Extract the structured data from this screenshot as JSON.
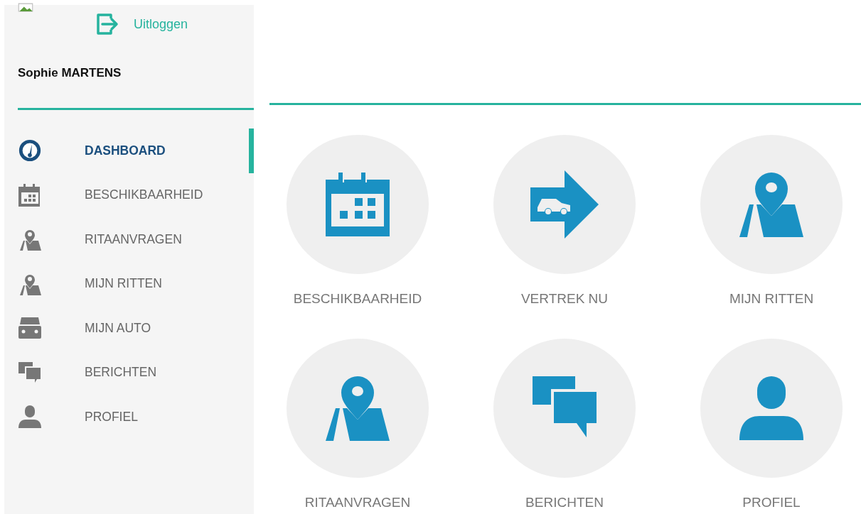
{
  "logout": {
    "label": "Uitloggen"
  },
  "user": {
    "name": "Sophie MARTENS"
  },
  "menu": [
    {
      "label": "DASHBOARD",
      "kind": "gauge",
      "selected": true
    },
    {
      "label": "BESCHIKBAARHEID",
      "kind": "calendar",
      "selected": false
    },
    {
      "label": "RITAANVRAGEN",
      "kind": "map",
      "selected": false
    },
    {
      "label": "MIJN RITTEN",
      "kind": "map",
      "selected": false
    },
    {
      "label": "MIJN AUTO",
      "kind": "car",
      "selected": false
    },
    {
      "label": "BERICHTEN",
      "kind": "chat",
      "selected": false
    },
    {
      "label": "PROFIEL",
      "kind": "person",
      "selected": false
    }
  ],
  "tiles": [
    {
      "label": "BESCHIKBAARHEID",
      "kind": "calendar"
    },
    {
      "label": "VERTREK NU",
      "kind": "depart"
    },
    {
      "label": "MIJN RITTEN",
      "kind": "map"
    },
    {
      "label": "RITAANVRAGEN",
      "kind": "map"
    },
    {
      "label": "BERICHTEN",
      "kind": "chat"
    },
    {
      "label": "PROFIEL",
      "kind": "person"
    }
  ]
}
